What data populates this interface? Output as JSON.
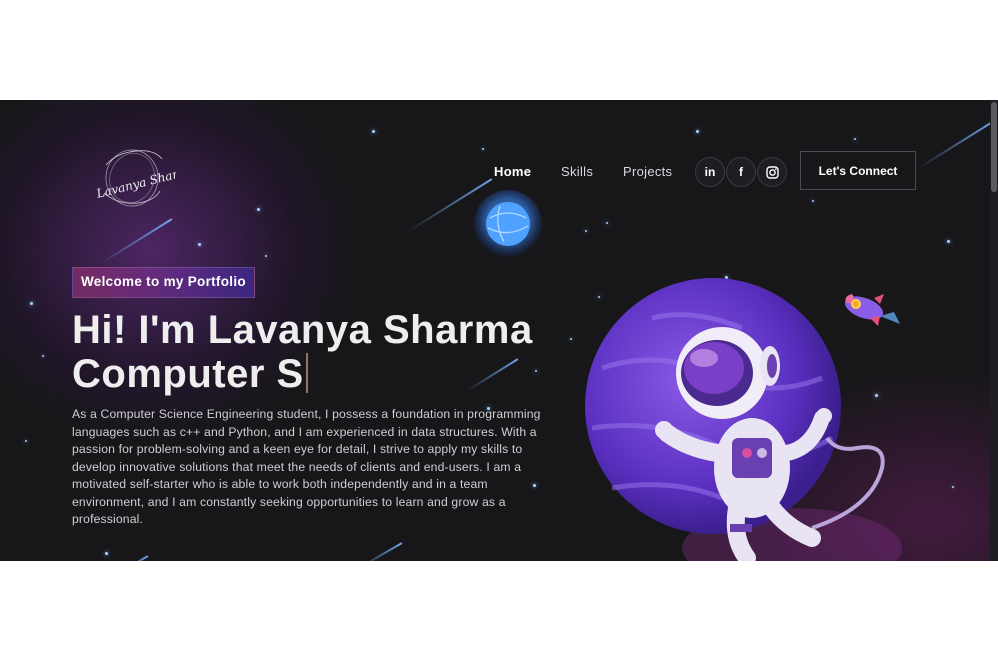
{
  "logo": {
    "text": "Lavanya Sharma"
  },
  "nav": {
    "links": [
      "Home",
      "Skills",
      "Projects"
    ],
    "active": "Home",
    "social": [
      {
        "name": "linkedin",
        "glyph": "in"
      },
      {
        "name": "facebook",
        "glyph": "f"
      },
      {
        "name": "instagram",
        "glyph": "instagram-icon"
      }
    ],
    "cta": "Let's Connect"
  },
  "hero": {
    "tagline": "Welcome to my Portfolio",
    "headline_line1": "Hi! I'm Lavanya Sharma",
    "headline_line2": "Computer S",
    "about": "As a Computer Science Engineering student, I possess a foundation in programming languages such as c++ and Python, and I am experienced in data structures. With a passion for problem-solving and a keen eye for detail, I strive to apply my skills to develop innovative solutions that meet the needs of clients and end-users. I am a motivated self-starter who is able to work both independently and in a team environment, and I am constantly seeking opportunities to learn and grow as a professional."
  },
  "colors": {
    "background": "#171719",
    "accent_pink": "#aa367c",
    "accent_purple": "#4a2fbd",
    "text": "#eeeeee"
  }
}
